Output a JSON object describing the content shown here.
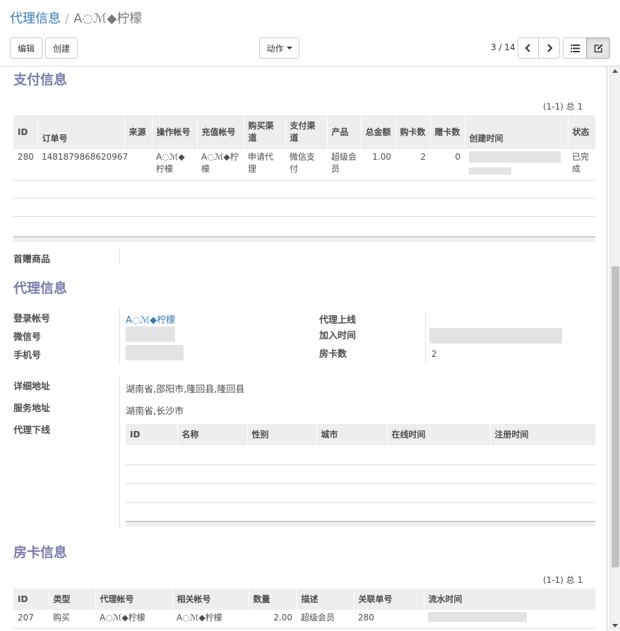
{
  "breadcrumb": {
    "parent": "代理信息",
    "separator": "/",
    "current": "A◌ℳ◆柠檬"
  },
  "toolbar": {
    "edit": "编辑",
    "create": "创建",
    "action": "动作"
  },
  "pager": {
    "value": "3 / 14"
  },
  "icons": {
    "prev": "chevron-left-icon",
    "next": "chevron-right-icon",
    "list_view": "list-view-icon",
    "form_view": "form-edit-icon"
  },
  "payment": {
    "title": "支付信息",
    "count": "(1-1) 总 1",
    "headers": [
      "ID",
      "订单号",
      "来源",
      "操作帐号",
      "充值帐号",
      "购买渠道",
      "支付渠道",
      "产品",
      "总金额",
      "购卡数",
      "赠卡数",
      "创建时间",
      "状态"
    ],
    "row": {
      "id": "280",
      "order_no": "1481879868620967",
      "source": "",
      "operator": "A◌ℳ◆柠檬",
      "recharge": "A◌ℳ◆柠檬",
      "buy_channel": "申请代理",
      "pay_channel": "微信支付",
      "product": "超级会员",
      "amount": "1.00",
      "cards_bought": "2",
      "cards_gift": "0",
      "status": "已完成"
    },
    "gift_label": "首赠商品"
  },
  "agent": {
    "title": "代理信息",
    "login_label": "登录帐号",
    "login_value": "A◌ℳ◆柠檬",
    "wechat_label": "微信号",
    "phone_label": "手机号",
    "upline_label": "代理上线",
    "join_label": "加入时间",
    "cards_label": "房卡数",
    "cards_value": "2",
    "address_label": "详细地址",
    "address_value": "湖南省,邵阳市,隆回县,隆回县",
    "service_label": "服务地址",
    "service_value": "湖南省,长沙市",
    "downline_label": "代理下线",
    "downline_headers": [
      "ID",
      "名称",
      "性别",
      "城市",
      "在线时间",
      "注册时间"
    ]
  },
  "cards": {
    "title": "房卡信息",
    "count": "(1-1) 总 1",
    "headers": [
      "ID",
      "类型",
      "代理帐号",
      "相关帐号",
      "数量",
      "描述",
      "关联单号",
      "流水时间"
    ],
    "row": {
      "id": "207",
      "type": "购买",
      "agent": "A◌ℳ◆柠檬",
      "related": "A◌ℳ◆柠檬",
      "qty": "2.00",
      "desc": "超级会员",
      "ref_no": "280"
    }
  }
}
